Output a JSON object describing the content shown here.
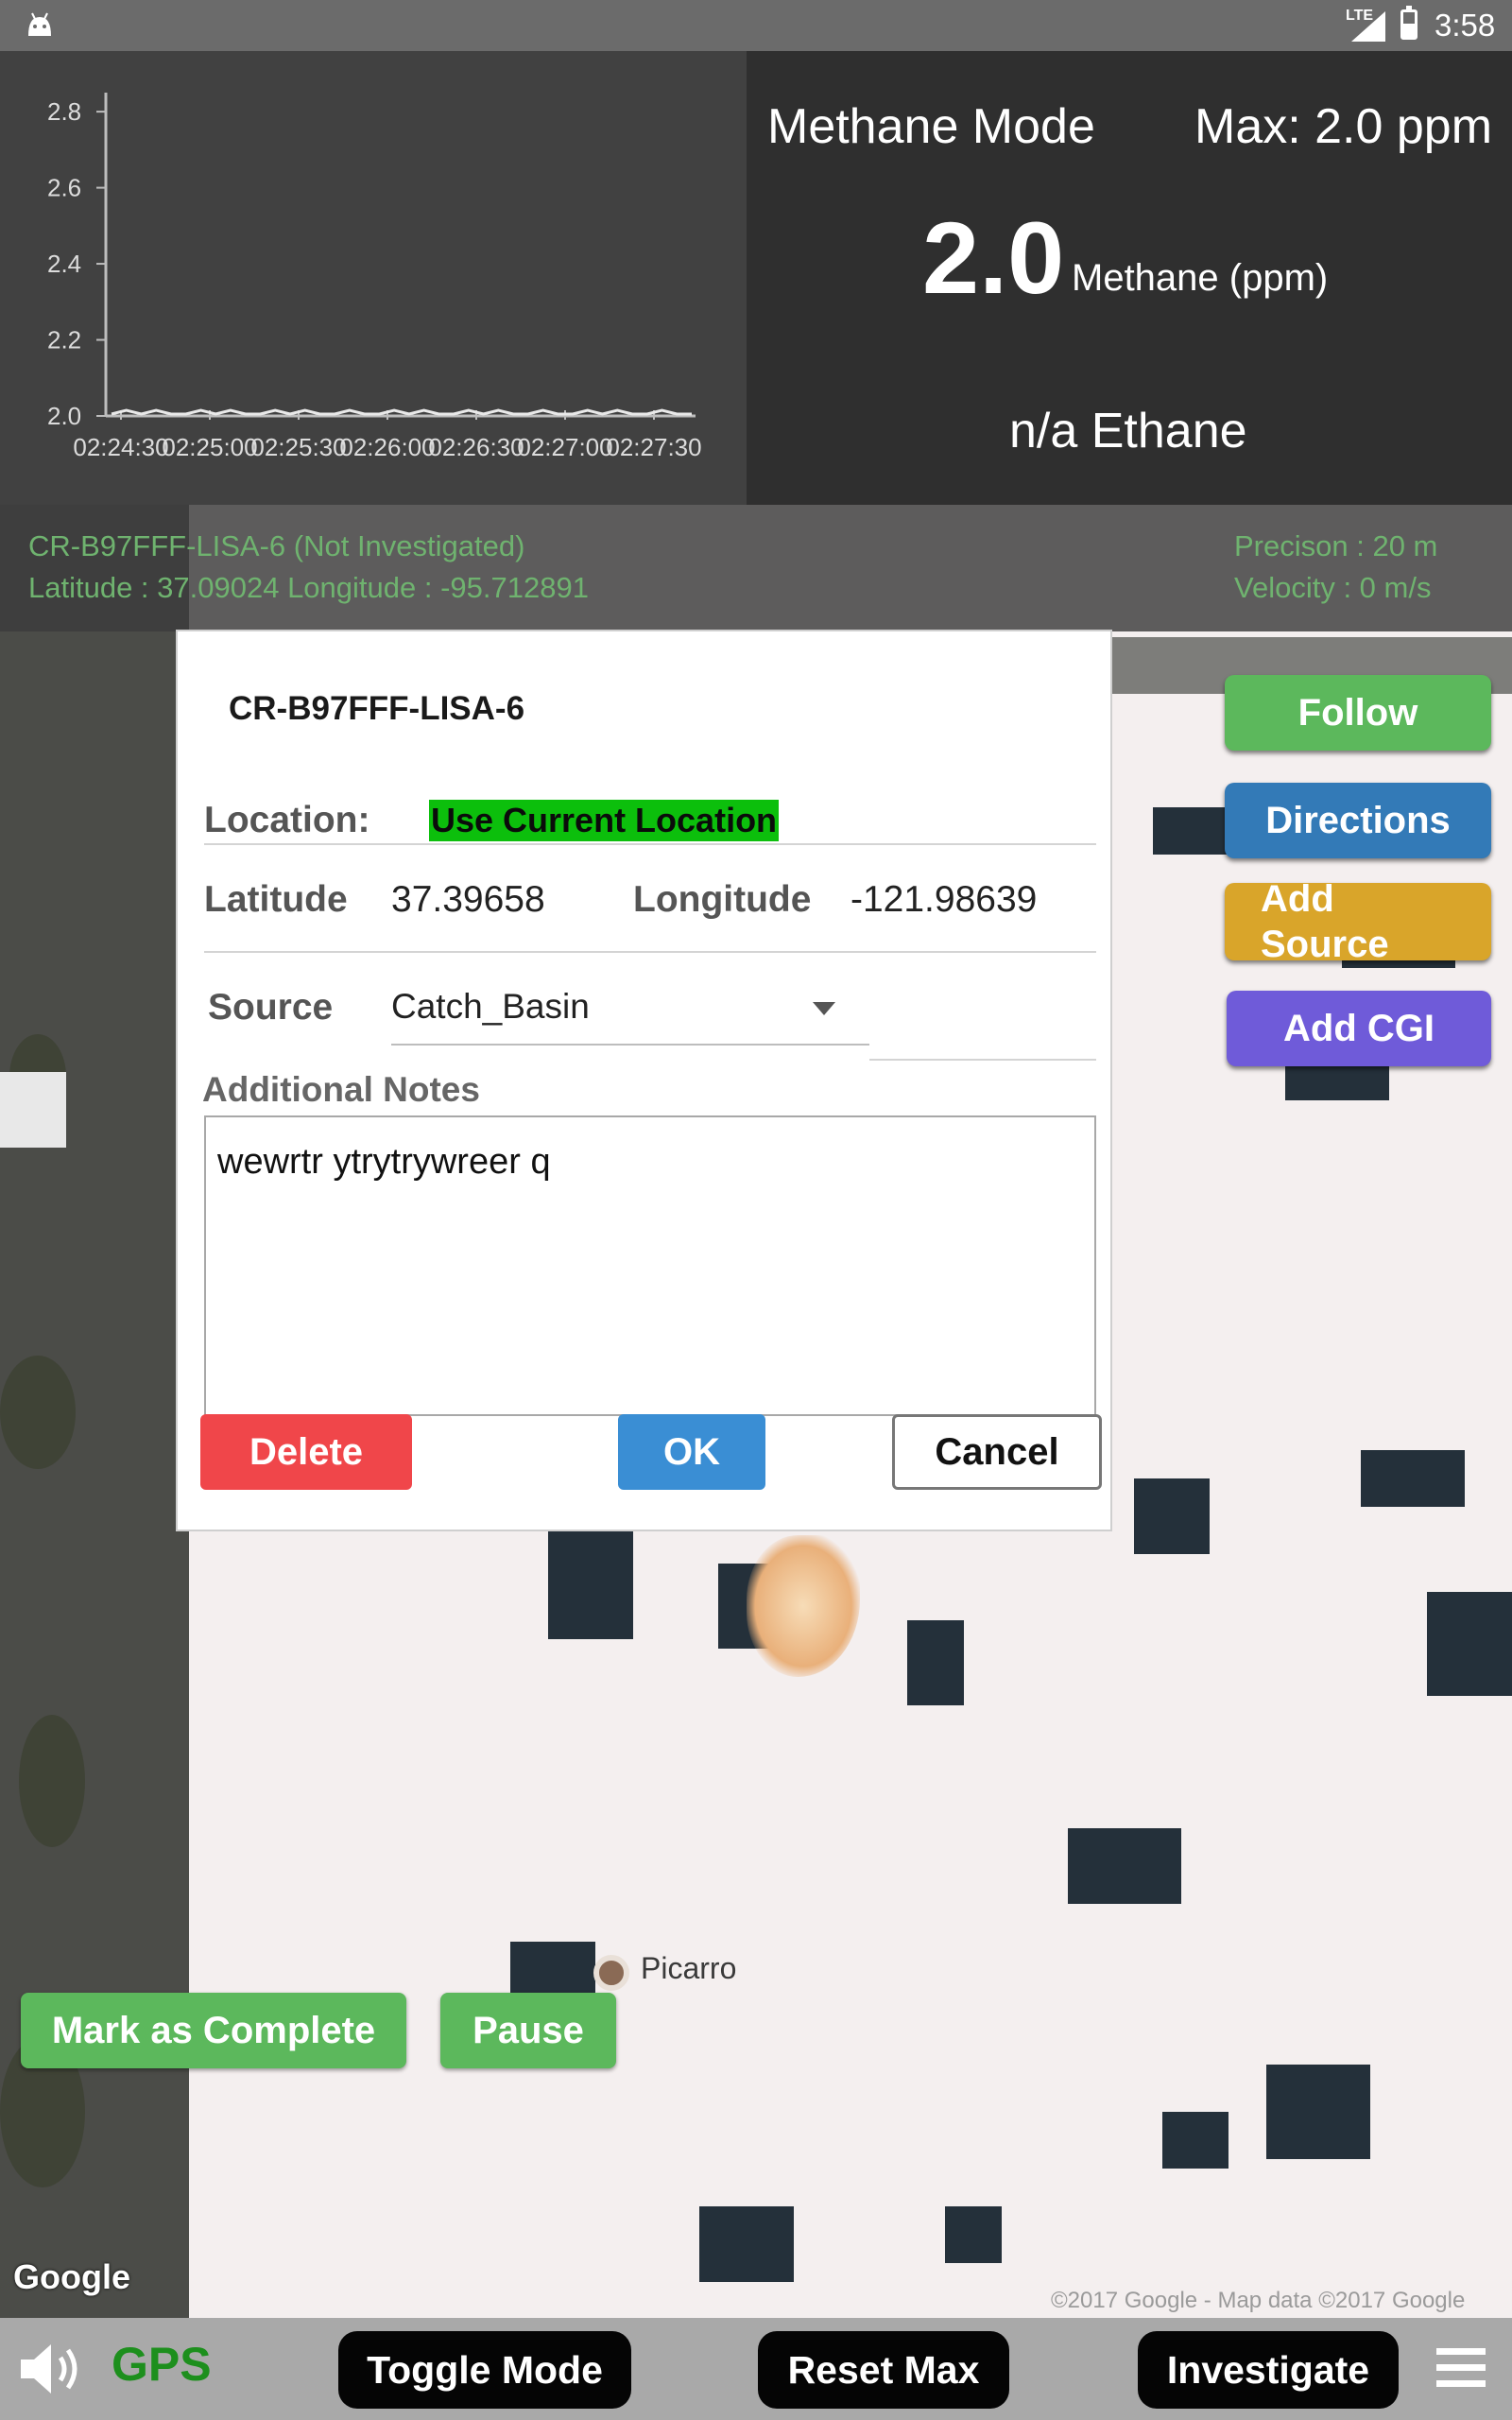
{
  "status_bar": {
    "network": "LTE",
    "time": "3:58"
  },
  "chart_data": {
    "type": "line",
    "title": "",
    "xlabel": "",
    "ylabel": "",
    "x_ticks": [
      "02:24:30",
      "02:25:00",
      "02:25:30",
      "02:26:00",
      "02:26:30",
      "02:27:00",
      "02:27:30"
    ],
    "y_ticks": [
      "2.0",
      "2.2",
      "2.4",
      "2.6",
      "2.8"
    ],
    "ylim": [
      2.0,
      2.85
    ],
    "series": [
      {
        "values": [
          2.0,
          2.01,
          2.0,
          2.01,
          2.0,
          2.0,
          2.01,
          2.0,
          2.01,
          2.0,
          2.0,
          2.01,
          2.0,
          2.01,
          2.0,
          2.0,
          2.01,
          2.0,
          2.0,
          2.01,
          2.0,
          2.01,
          2.0,
          2.0,
          2.01,
          2.0,
          2.01,
          2.0,
          2.0,
          2.01,
          2.0,
          2.0,
          2.01,
          2.0,
          2.01,
          2.0,
          2.0,
          2.01,
          2.0,
          2.0
        ]
      }
    ]
  },
  "reading": {
    "mode": "Methane Mode",
    "max": "Max: 2.0 ppm",
    "value": "2.0",
    "unit": "Methane (ppm)",
    "ethane": "n/a Ethane"
  },
  "info": {
    "name": "CR-B97FFF-LISA-6  (Not Investigated)",
    "coords": "Latitude : 37.09024  Longitude  :  -95.712891",
    "precision": "Precison : 20  m",
    "velocity": "Velocity : 0  m/s"
  },
  "side_buttons": {
    "follow": "Follow",
    "directions": "Directions",
    "add_source": "Add Source",
    "add_cgi": "Add CGI"
  },
  "dialog": {
    "title": "CR-B97FFF-LISA-6",
    "location_label": "Location:",
    "use_current": "Use Current Location",
    "latitude_label": "Latitude",
    "latitude_value": "37.39658",
    "longitude_label": "Longitude",
    "longitude_value": "-121.98639",
    "source_label": "Source",
    "source_value": "Catch_Basin",
    "notes_label": "Additional Notes",
    "notes_value": "wewrtr ytrytrywreer q",
    "delete": "Delete",
    "ok": "OK",
    "cancel": "Cancel"
  },
  "map": {
    "marker_label": "Picarro",
    "google": "Google",
    "attribution": "©2017 Google - Map data ©2017 Google"
  },
  "map_buttons": {
    "mark_complete": "Mark as Complete",
    "pause": "Pause"
  },
  "bottom_bar": {
    "gps": "GPS",
    "toggle_mode": "Toggle Mode",
    "reset_max": "Reset Max",
    "investigate": "Investigate"
  },
  "colors": {
    "follow": "#5cb85c",
    "directions": "#337ab7",
    "add_source": "#d9a52a",
    "add_cgi": "#6f5bd9",
    "delete": "#f0464a",
    "ok": "#3a8ed4",
    "use_current": "#0cbf0c"
  }
}
